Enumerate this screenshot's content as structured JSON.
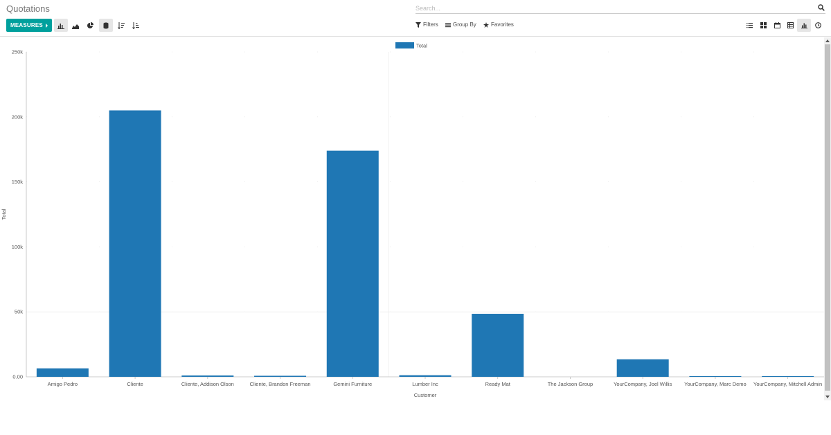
{
  "header": {
    "title": "Quotations",
    "search_placeholder": "Search..."
  },
  "toolbar": {
    "measures_label": "MEASURES",
    "filters_label": "Filters",
    "group_by_label": "Group By",
    "favorites_label": "Favorites"
  },
  "icons": {
    "chart_types": [
      "bar-chart-icon",
      "line-chart-icon",
      "pie-chart-icon",
      "stacked-icon"
    ],
    "sort": [
      "sort-descending-icon",
      "sort-ascending-icon"
    ],
    "views": [
      "list-view-icon",
      "kanban-view-icon",
      "calendar-view-icon",
      "pivot-view-icon",
      "graph-view-icon",
      "activity-view-icon"
    ]
  },
  "colors": {
    "accent": "#00a09d",
    "bar": "#1f77b4"
  },
  "chart_data": {
    "type": "bar",
    "categories": [
      "Amigo Pedro",
      "Cliente",
      "Cliente, Addison Olson",
      "Cliente, Brandon Freeman",
      "Gemini Furniture",
      "Lumber Inc",
      "Ready Mat",
      "The Jackson Group",
      "YourCompany, Joel Willis",
      "YourCompany, Marc Demo",
      "YourCompany, Mitchell Admin"
    ],
    "series": [
      {
        "name": "Total",
        "values": [
          6500,
          205000,
          1000,
          800,
          174000,
          1200,
          48500,
          0,
          13500,
          300,
          500
        ]
      }
    ],
    "xlabel": "Customer",
    "ylabel": "Total",
    "ylim": [
      0,
      250000
    ],
    "yticks": [
      "0.00",
      "50k",
      "100k",
      "150k",
      "200k",
      "250k"
    ],
    "ytick_values": [
      0,
      50000,
      100000,
      150000,
      200000,
      250000
    ],
    "legend": "top-center",
    "grid": true
  }
}
